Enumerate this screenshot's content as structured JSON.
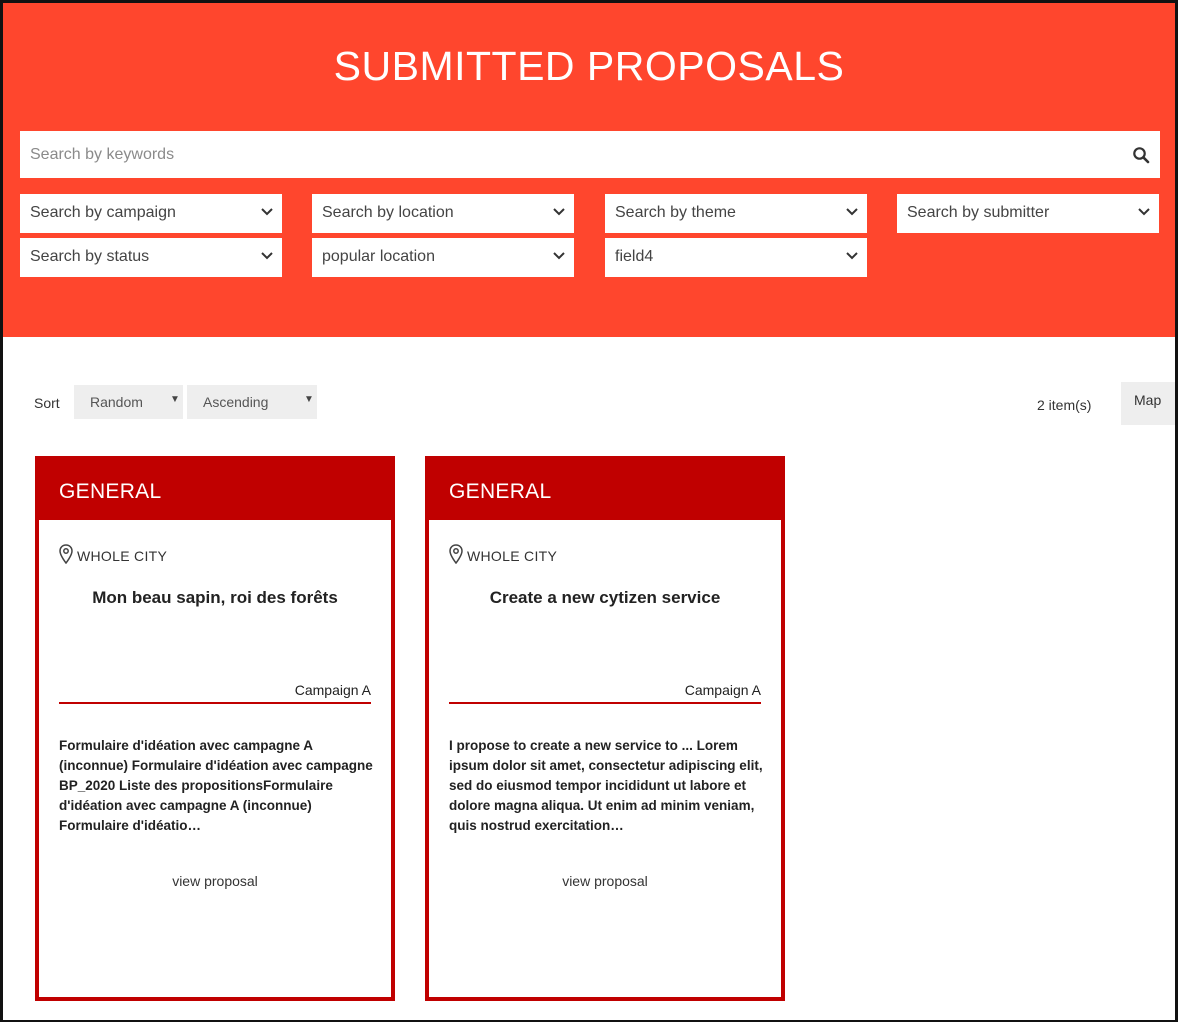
{
  "header": {
    "title": "SUBMITTED PROPOSALS"
  },
  "search": {
    "placeholder": "Search by keywords"
  },
  "filters": {
    "campaign": "Search by campaign",
    "location": "Search by location",
    "theme": "Search by theme",
    "submitter": "Search by submitter",
    "status": "Search by status",
    "popular_location": "popular location",
    "field4": "field4"
  },
  "sort": {
    "label": "Sort",
    "field": "Random",
    "order": "Ascending"
  },
  "results": {
    "count": "2 item(s)",
    "map_label": "Map"
  },
  "colors": {
    "hero": "#ff462d",
    "card_accent": "#c00000"
  },
  "cards": [
    {
      "theme": "GENERAL",
      "location": "WHOLE CITY",
      "title": "Mon beau sapin, roi des forêts",
      "campaign": "Campaign A",
      "description": "Formulaire d'idéation avec campagne A (inconnue) Formulaire d'idéation avec campagne BP_2020 Liste des propositionsFormulaire d'idéation avec campagne A (inconnue) Formulaire d'idéatio…",
      "link": "view proposal"
    },
    {
      "theme": "GENERAL",
      "location": "WHOLE CITY",
      "title": "Create a new cytizen service",
      "campaign": "Campaign A",
      "description": "I propose to create a new service to ... Lorem ipsum dolor sit amet, consectetur adipiscing elit, sed do eiusmod tempor incididunt ut labore et dolore magna aliqua. Ut enim ad minim veniam, quis nostrud exercitation…",
      "link": "view proposal"
    }
  ]
}
